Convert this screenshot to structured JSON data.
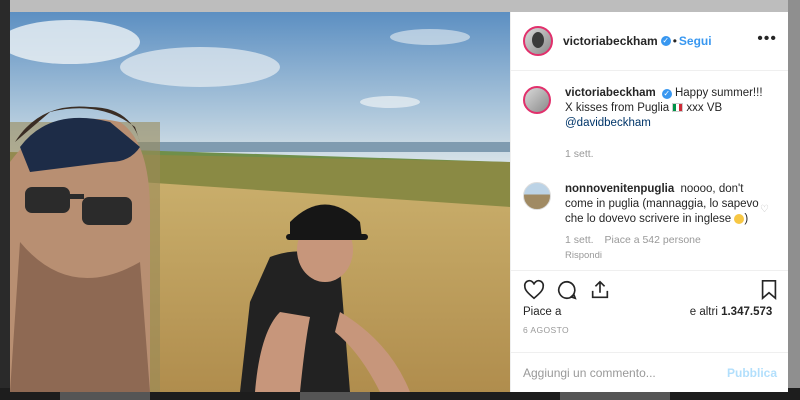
{
  "post": {
    "username": "victoriabeckham",
    "verified_glyph": "✓",
    "separator": "•",
    "follow_label": "Segui",
    "more_icon": "•••"
  },
  "caption": {
    "username": "victoriabeckham",
    "text": "Happy summer!!! X kisses from Puglia",
    "flag_icon": "italy-flag-icon",
    "text2": "xxx VB",
    "mention": "@davidbeckham",
    "time": "1 sett."
  },
  "comment": {
    "username": "nonnovenitenpuglia",
    "text": "noooo, don't come in puglia (mannaggia, lo sapevo che lo dovevo scrivere in inglese",
    "emoji_icon": "smile-emoji-icon",
    "time": "1 sett.",
    "likes": "Piace a 542 persone",
    "reply_label": "Rispondi"
  },
  "likes": {
    "prefix": "Piace a",
    "suffix": "e altri",
    "count": "1.347.573"
  },
  "date": "6 AGOSTO",
  "add_comment": {
    "placeholder": "Aggiungi un commento...",
    "publish_label": "Pubblica"
  },
  "colors": {
    "accent": "#3897f0",
    "publish_disabled": "#b2dffc",
    "story_ring": "#e1306c"
  }
}
